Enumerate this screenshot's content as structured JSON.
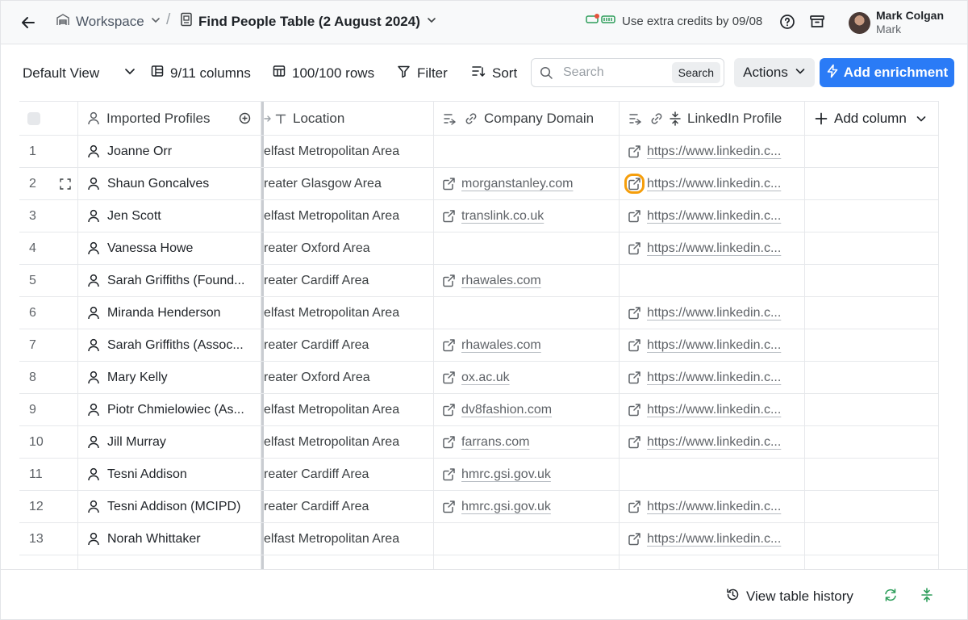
{
  "header": {
    "workspace_label": "Workspace",
    "separator": "/",
    "table_title": "Find People Table (2 August 2024)",
    "credits_text": "Use extra credits by 09/08",
    "user_name": "Mark Colgan",
    "user_sub": "Mark"
  },
  "toolbar": {
    "view_label": "Default View",
    "columns_label": "9/11 columns",
    "rows_label": "100/100 rows",
    "filter_label": "Filter",
    "sort_label": "Sort",
    "search_placeholder": "Search",
    "search_button": "Search",
    "actions_label": "Actions",
    "enrich_label": "Add enrichment"
  },
  "table": {
    "columns": {
      "profiles": "Imported Profiles",
      "location": "Location",
      "domain": "Company Domain",
      "linkedin": "LinkedIn Profile",
      "add_column": "Add column"
    },
    "rows": [
      {
        "num": "1",
        "name": "Joanne Orr",
        "location": "elfast Metropolitan Area",
        "domain": "",
        "linkedin": "https://www.linkedin.c..."
      },
      {
        "num": "2",
        "name": "Shaun Goncalves",
        "location": "reater Glasgow Area",
        "domain": "morganstanley.com",
        "linkedin": "https://www.linkedin.c..."
      },
      {
        "num": "3",
        "name": "Jen Scott",
        "location": "elfast Metropolitan Area",
        "domain": "translink.co.uk",
        "linkedin": "https://www.linkedin.c..."
      },
      {
        "num": "4",
        "name": "Vanessa Howe",
        "location": "reater Oxford Area",
        "domain": "",
        "linkedin": "https://www.linkedin.c..."
      },
      {
        "num": "5",
        "name": "Sarah Griffiths (Found...",
        "location": "reater Cardiff Area",
        "domain": "rhawales.com",
        "linkedin": ""
      },
      {
        "num": "6",
        "name": "Miranda Henderson",
        "location": "elfast Metropolitan Area",
        "domain": "",
        "linkedin": "https://www.linkedin.c..."
      },
      {
        "num": "7",
        "name": "Sarah Griffiths (Assoc...",
        "location": "reater Cardiff Area",
        "domain": "rhawales.com",
        "linkedin": "https://www.linkedin.c..."
      },
      {
        "num": "8",
        "name": "Mary Kelly",
        "location": "reater Oxford Area",
        "domain": "ox.ac.uk",
        "linkedin": "https://www.linkedin.c..."
      },
      {
        "num": "9",
        "name": "Piotr Chmielowiec (As...",
        "location": "elfast Metropolitan Area",
        "domain": "dv8fashion.com",
        "linkedin": "https://www.linkedin.c..."
      },
      {
        "num": "10",
        "name": "Jill Murray",
        "location": "elfast Metropolitan Area",
        "domain": "farrans.com",
        "linkedin": "https://www.linkedin.c..."
      },
      {
        "num": "11",
        "name": "Tesni Addison",
        "location": "reater Cardiff Area",
        "domain": "hmrc.gsi.gov.uk",
        "linkedin": ""
      },
      {
        "num": "12",
        "name": "Tesni Addison (MCIPD)",
        "location": "reater Cardiff Area",
        "domain": "hmrc.gsi.gov.uk",
        "linkedin": "https://www.linkedin.c..."
      },
      {
        "num": "13",
        "name": "Norah Whittaker",
        "location": "elfast Metropolitan Area",
        "domain": "",
        "linkedin": "https://www.linkedin.c..."
      }
    ]
  },
  "footer": {
    "history_label": "View table history"
  },
  "colors": {
    "primary": "#2a7bf6",
    "credits_green": "#2e9e5b",
    "focus_ring": "#f59e0b"
  }
}
